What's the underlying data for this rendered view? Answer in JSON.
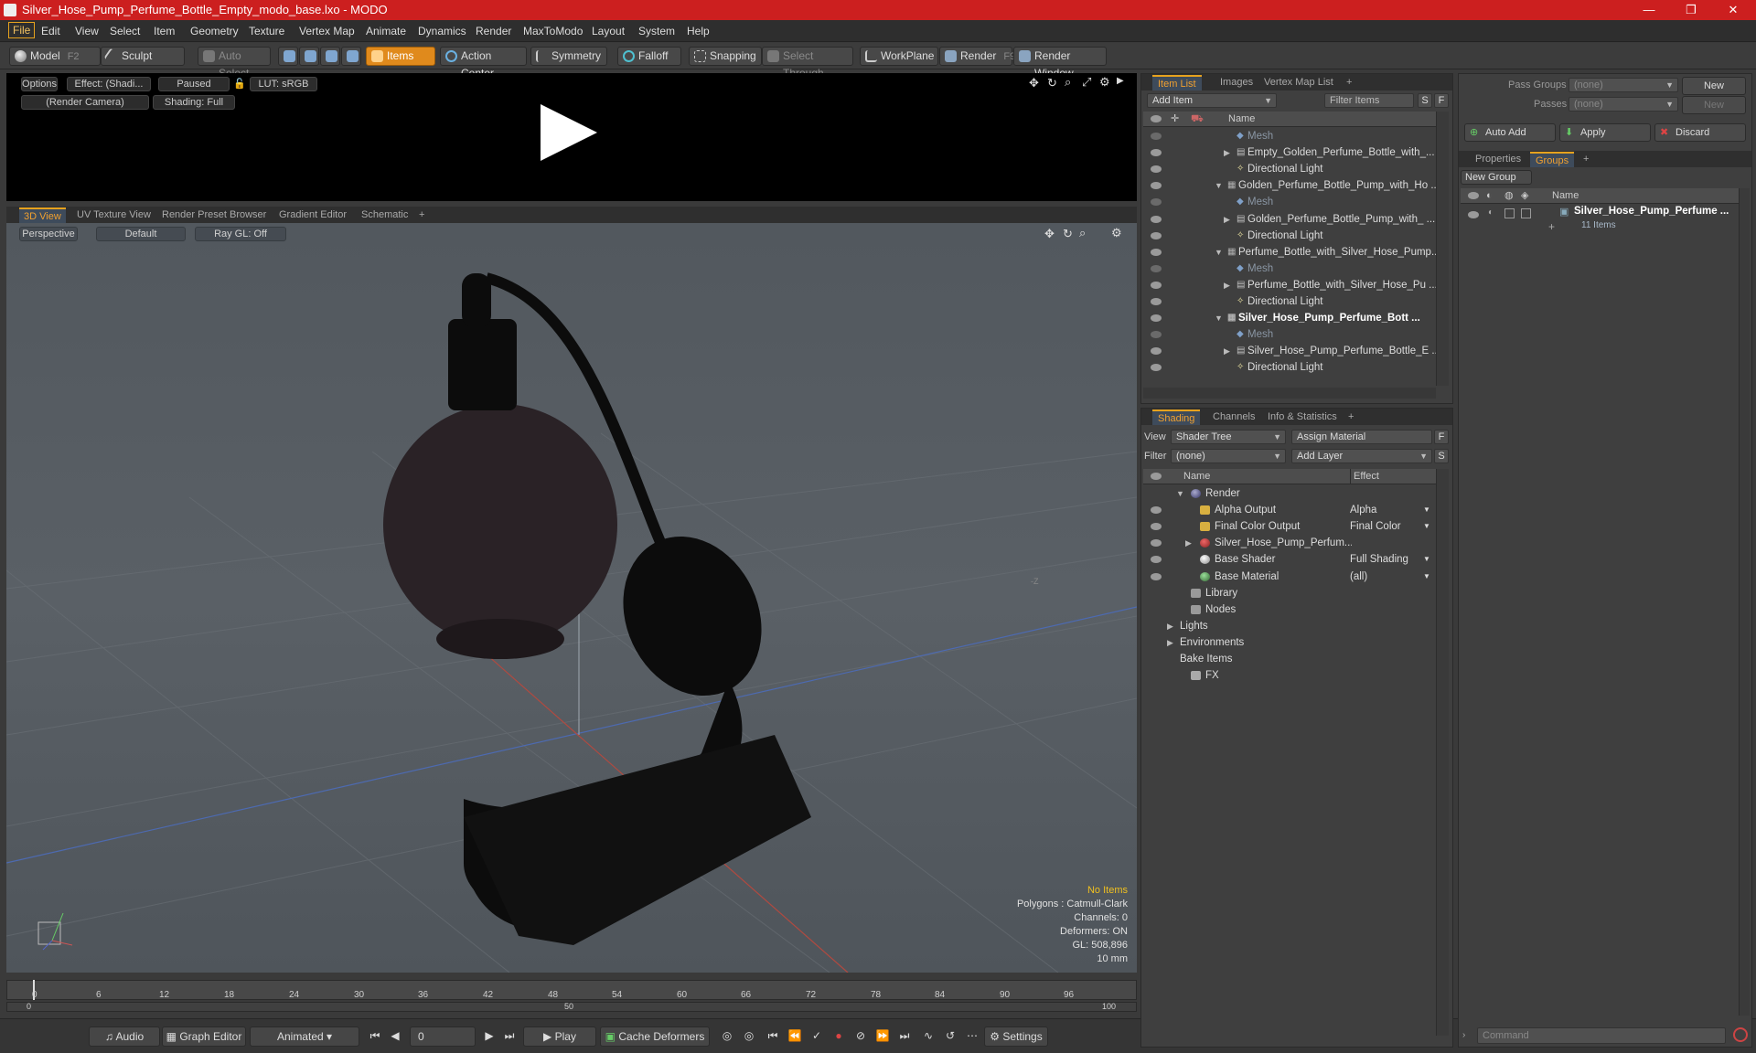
{
  "window": {
    "title": "Silver_Hose_Pump_Perfume_Bottle_Empty_modo_base.lxo - MODO",
    "min": "—",
    "max": "❐",
    "close": "✕"
  },
  "menu": [
    "File",
    "Edit",
    "View",
    "Select",
    "Item",
    "Geometry",
    "Texture",
    "Vertex Map",
    "Animate",
    "Dynamics",
    "Render",
    "MaxToModo",
    "Layout",
    "System",
    "Help"
  ],
  "toolbar": {
    "model": "Model",
    "model_key": "F2",
    "sculpt": "Sculpt",
    "auto_select": "Auto Select",
    "items": "Items",
    "action_center": "Action Center",
    "symmetry": "Symmetry",
    "falloff": "Falloff",
    "snapping": "Snapping",
    "select_through": "Select Through",
    "workplane": "WorkPlane",
    "render": "Render",
    "render_key": "F9",
    "render_window": "Render Window"
  },
  "preview": {
    "options": "Options",
    "effect": "Effect: (Shadi...",
    "paused": "Paused",
    "lut": "LUT: sRGB",
    "camera": "(Render Camera)",
    "shading": "Shading: Full"
  },
  "viewport_tabs": [
    "3D View",
    "UV Texture View",
    "Render Preset Browser",
    "Gradient Editor",
    "Schematic",
    "+"
  ],
  "viewport": {
    "perspective": "Perspective",
    "default": "Default",
    "raygl": "Ray GL: Off",
    "axis_label": "-Z",
    "stats": {
      "items": "No Items",
      "polygons": "Polygons : Catmull-Clark",
      "channels": "Channels: 0",
      "deformers": "Deformers: ON",
      "gl": "GL: 508,896",
      "scale": "10 mm"
    }
  },
  "timeline": {
    "ticks": [
      "0",
      "6",
      "12",
      "18",
      "24",
      "30",
      "36",
      "42",
      "48",
      "54",
      "60",
      "66",
      "72",
      "78",
      "84",
      "90",
      "96"
    ],
    "low": "0",
    "mid": "50",
    "high": "100"
  },
  "bottom": {
    "audio": "Audio",
    "graph_editor": "Graph Editor",
    "animated": "Animated",
    "frame": "0",
    "play": "Play",
    "cache": "Cache Deformers",
    "settings": "Settings"
  },
  "item_list": {
    "tabs": [
      "Item List",
      "Images",
      "Vertex Map List",
      "+"
    ],
    "add_item": "Add Item",
    "filter": "Filter Items",
    "s": "S",
    "f": "F",
    "col_name": "Name",
    "rows": [
      {
        "label": "Mesh",
        "type": "mesh",
        "indent": 2,
        "dim": true
      },
      {
        "label": "Empty_Golden_Perfume_Bottle_with_...",
        "type": "group",
        "indent": 2,
        "arrow": "▶"
      },
      {
        "label": "Directional Light",
        "type": "light",
        "indent": 2
      },
      {
        "label": "Golden_Perfume_Bottle_Pump_with_Ho ...",
        "type": "scene",
        "indent": 1,
        "arrow": "▼"
      },
      {
        "label": "Mesh",
        "type": "mesh",
        "indent": 2,
        "dim": true
      },
      {
        "label": "Golden_Perfume_Bottle_Pump_with_ ...",
        "type": "group",
        "indent": 2,
        "arrow": "▶"
      },
      {
        "label": "Directional Light",
        "type": "light",
        "indent": 2
      },
      {
        "label": "Perfume_Bottle_with_Silver_Hose_Pump...",
        "type": "scene",
        "indent": 1,
        "arrow": "▼"
      },
      {
        "label": "Mesh",
        "type": "mesh",
        "indent": 2,
        "dim": true
      },
      {
        "label": "Perfume_Bottle_with_Silver_Hose_Pu ...",
        "type": "group",
        "indent": 2,
        "arrow": "▶"
      },
      {
        "label": "Directional Light",
        "type": "light",
        "indent": 2
      },
      {
        "label": "Silver_Hose_Pump_Perfume_Bott ...",
        "type": "scene",
        "indent": 1,
        "arrow": "▼",
        "bold": true
      },
      {
        "label": "Mesh",
        "type": "mesh",
        "indent": 2,
        "dim": true
      },
      {
        "label": "Silver_Hose_Pump_Perfume_Bottle_E ...",
        "type": "group",
        "indent": 2,
        "arrow": "▶"
      },
      {
        "label": "Directional Light",
        "type": "light",
        "indent": 2
      }
    ]
  },
  "shading": {
    "tabs": [
      "Shading",
      "Channels",
      "Info & Statistics",
      "+"
    ],
    "view_label": "View",
    "view_value": "Shader Tree",
    "assign": "Assign Material",
    "filter_label": "Filter",
    "filter_value": "(none)",
    "add_layer": "Add Layer",
    "f": "F",
    "s": "S",
    "col_name": "Name",
    "col_effect": "Effect",
    "rows": [
      {
        "label": "Render",
        "effect": "",
        "icon": "render",
        "indent": 1,
        "arrow": "▼",
        "eye": false
      },
      {
        "label": "Alpha Output",
        "effect": "Alpha",
        "icon": "output",
        "indent": 2,
        "eye": true
      },
      {
        "label": "Final Color Output",
        "effect": "Final Color",
        "icon": "output",
        "indent": 2,
        "eye": true
      },
      {
        "label": "Silver_Hose_Pump_Perfum...",
        "effect": "",
        "icon": "material",
        "indent": 2,
        "arrow": "▶",
        "eye": true
      },
      {
        "label": "Base Shader",
        "effect": "Full Shading",
        "icon": "shader",
        "indent": 2,
        "eye": true
      },
      {
        "label": "Base Material",
        "effect": "(all)",
        "icon": "basemat",
        "indent": 2,
        "eye": true
      },
      {
        "label": "Library",
        "effect": "",
        "icon": "folder",
        "indent": 1,
        "eye": false
      },
      {
        "label": "Nodes",
        "effect": "",
        "icon": "folder",
        "indent": 1,
        "eye": false
      },
      {
        "label": "Lights",
        "effect": "",
        "icon": "none",
        "indent": 0,
        "arrow": "▶",
        "eye": false
      },
      {
        "label": "Environments",
        "effect": "",
        "icon": "none",
        "indent": 0,
        "arrow": "▶",
        "eye": false
      },
      {
        "label": "Bake Items",
        "effect": "",
        "icon": "none",
        "indent": 0,
        "eye": false
      },
      {
        "label": "FX",
        "effect": "",
        "icon": "fx",
        "indent": 1,
        "eye": false
      }
    ]
  },
  "groups": {
    "pass_groups": "Pass Groups",
    "passes": "Passes",
    "none": "(none)",
    "new": "New",
    "auto_add": "Auto Add",
    "apply": "Apply",
    "discard": "Discard",
    "tabs": [
      "Properties",
      "Groups",
      "+"
    ],
    "new_group": "New Group",
    "col_name": "Name",
    "item": "Silver_Hose_Pump_Perfume ...",
    "item_count": "11 Items",
    "command": "Command"
  }
}
